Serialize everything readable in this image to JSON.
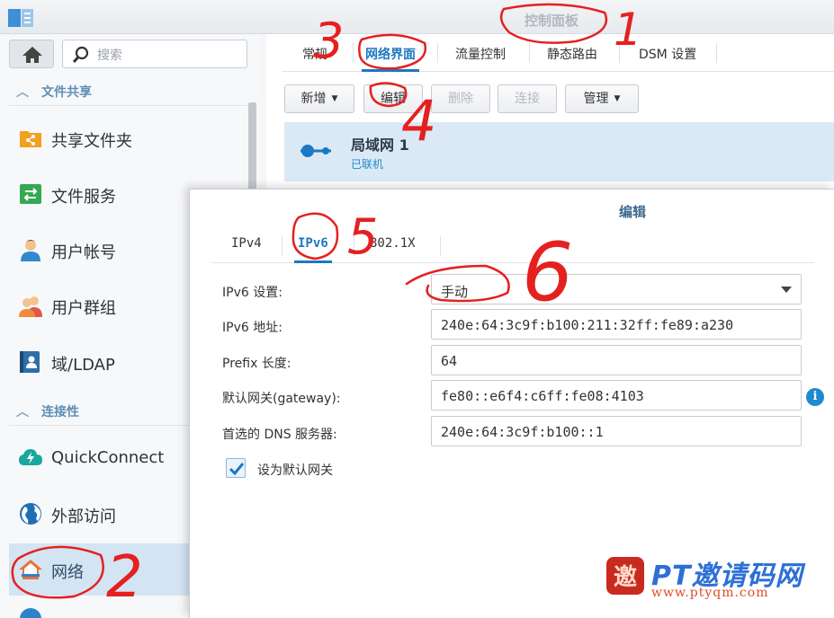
{
  "window": {
    "title": "控制面板"
  },
  "sidebar": {
    "search_placeholder": "搜索",
    "sections": [
      {
        "label": "文件共享"
      },
      {
        "label": "连接性"
      }
    ],
    "items": [
      {
        "label": "共享文件夹",
        "icon": "shared-folder-icon"
      },
      {
        "label": "文件服务",
        "icon": "file-services-icon"
      },
      {
        "label": "用户帐号",
        "icon": "user-icon"
      },
      {
        "label": "用户群组",
        "icon": "group-icon"
      },
      {
        "label": "域/LDAP",
        "icon": "domain-ldap-icon"
      },
      {
        "label": "QuickConnect",
        "icon": "quickconnect-cloud-icon"
      },
      {
        "label": "外部访问",
        "icon": "globe-icon"
      },
      {
        "label": "网络",
        "icon": "home-network-icon"
      }
    ],
    "active_item": "网络"
  },
  "main": {
    "tabs": [
      {
        "label": "常规"
      },
      {
        "label": "网络界面"
      },
      {
        "label": "流量控制"
      },
      {
        "label": "静态路由"
      },
      {
        "label": "DSM 设置"
      }
    ],
    "active_tab": "网络界面",
    "toolbar": {
      "create": "新增",
      "edit": "编辑",
      "delete": "删除",
      "connect": "连接",
      "manage": "管理"
    },
    "interface": {
      "name": "局域网 1",
      "status": "已联机"
    }
  },
  "dialog": {
    "title": "编辑",
    "tabs": [
      {
        "label": "IPv4"
      },
      {
        "label": "IPv6"
      },
      {
        "label": "802.1X"
      }
    ],
    "active_tab": "IPv6",
    "fields": [
      {
        "label": "IPv6 设置:",
        "value": "手动"
      },
      {
        "label": "IPv6 地址:",
        "value": "240e:64:3c9f:b100:211:32ff:fe89:a230"
      },
      {
        "label": "Prefix 长度:",
        "value": "64"
      },
      {
        "label": "默认网关(gateway):",
        "value": "fe80::e6f4:c6ff:fe08:4103"
      },
      {
        "label": "首选的 DNS 服务器:",
        "value": "240e:64:3c9f:b100::1"
      }
    ],
    "default_gateway_checkbox": {
      "label": "设为默认网关",
      "checked": true
    }
  },
  "annotations": [
    "1",
    "2",
    "3",
    "4",
    "5",
    "6"
  ],
  "watermark": {
    "text": "PT邀请码网",
    "url": "www.ptyqm.com",
    "logo_char": "邀"
  },
  "colors": {
    "accent": "#1d78c1",
    "annotation_red": "#e52020",
    "active_nav_bg": "#d3e4f3"
  }
}
